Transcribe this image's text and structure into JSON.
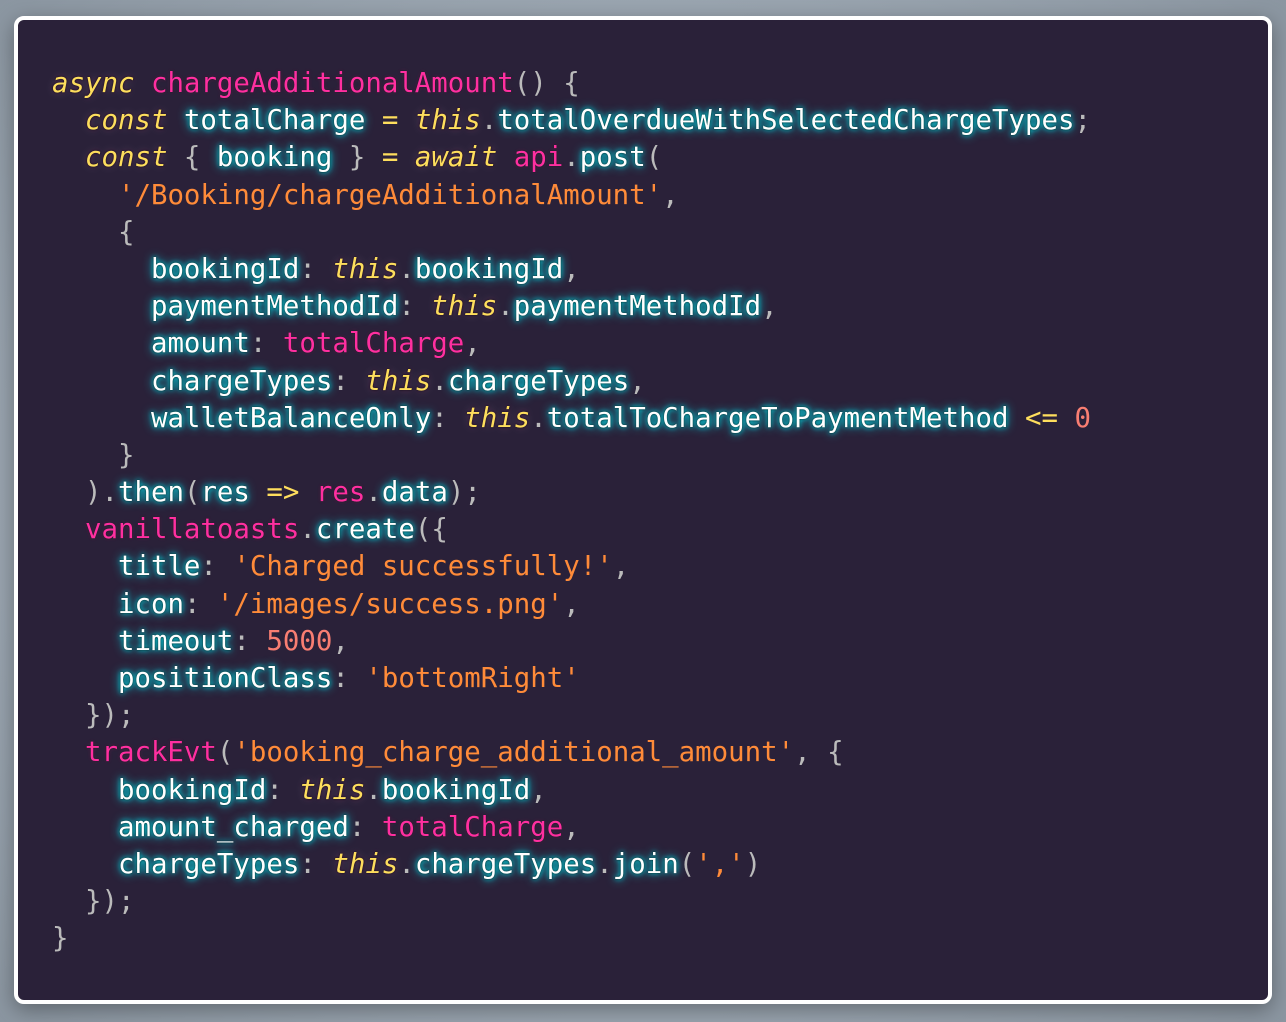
{
  "editor": {
    "language": "javascript",
    "colors": {
      "background": "#2a2139",
      "identifier": "#ffffff",
      "keyword": "#fede5d",
      "function": "#ff2fa0",
      "string": "#ff8b39",
      "number": "#f97e72",
      "punctuation": "#bbbbbb",
      "frame_border": "#ffffff"
    },
    "lines": [
      [
        {
          "k": "kw",
          "v": "async"
        },
        {
          "k": "p",
          "v": " "
        },
        {
          "k": "fn",
          "v": "chargeAdditionalAmount"
        },
        {
          "k": "p",
          "v": "() {"
        }
      ],
      [
        {
          "k": "p",
          "v": "  "
        },
        {
          "k": "kw",
          "v": "const"
        },
        {
          "k": "p",
          "v": " "
        },
        {
          "k": "t",
          "v": "totalCharge"
        },
        {
          "k": "p",
          "v": " "
        },
        {
          "k": "op",
          "v": "="
        },
        {
          "k": "p",
          "v": " "
        },
        {
          "k": "kw",
          "v": "this"
        },
        {
          "k": "p",
          "v": "."
        },
        {
          "k": "t",
          "v": "totalOverdueWithSelectedChargeTypes"
        },
        {
          "k": "p",
          "v": ";"
        }
      ],
      [
        {
          "k": "p",
          "v": "  "
        },
        {
          "k": "kw",
          "v": "const"
        },
        {
          "k": "p",
          "v": " { "
        },
        {
          "k": "t",
          "v": "booking"
        },
        {
          "k": "p",
          "v": " } "
        },
        {
          "k": "op",
          "v": "="
        },
        {
          "k": "p",
          "v": " "
        },
        {
          "k": "kw",
          "v": "await"
        },
        {
          "k": "p",
          "v": " "
        },
        {
          "k": "fn",
          "v": "api"
        },
        {
          "k": "p",
          "v": "."
        },
        {
          "k": "t",
          "v": "post"
        },
        {
          "k": "p",
          "v": "("
        }
      ],
      [
        {
          "k": "p",
          "v": "    "
        },
        {
          "k": "str",
          "v": "'/Booking/chargeAdditionalAmount'"
        },
        {
          "k": "p",
          "v": ","
        }
      ],
      [
        {
          "k": "p",
          "v": "    {"
        }
      ],
      [
        {
          "k": "p",
          "v": "      "
        },
        {
          "k": "t",
          "v": "bookingId"
        },
        {
          "k": "p",
          "v": ": "
        },
        {
          "k": "kw",
          "v": "this"
        },
        {
          "k": "p",
          "v": "."
        },
        {
          "k": "t",
          "v": "bookingId"
        },
        {
          "k": "p",
          "v": ","
        }
      ],
      [
        {
          "k": "p",
          "v": "      "
        },
        {
          "k": "t",
          "v": "paymentMethodId"
        },
        {
          "k": "p",
          "v": ": "
        },
        {
          "k": "kw",
          "v": "this"
        },
        {
          "k": "p",
          "v": "."
        },
        {
          "k": "t",
          "v": "paymentMethodId"
        },
        {
          "k": "p",
          "v": ","
        }
      ],
      [
        {
          "k": "p",
          "v": "      "
        },
        {
          "k": "t",
          "v": "amount"
        },
        {
          "k": "p",
          "v": ": "
        },
        {
          "k": "fn",
          "v": "totalCharge"
        },
        {
          "k": "p",
          "v": ","
        }
      ],
      [
        {
          "k": "p",
          "v": "      "
        },
        {
          "k": "t",
          "v": "chargeTypes"
        },
        {
          "k": "p",
          "v": ": "
        },
        {
          "k": "kw",
          "v": "this"
        },
        {
          "k": "p",
          "v": "."
        },
        {
          "k": "t",
          "v": "chargeTypes"
        },
        {
          "k": "p",
          "v": ","
        }
      ],
      [
        {
          "k": "p",
          "v": "      "
        },
        {
          "k": "t",
          "v": "walletBalanceOnly"
        },
        {
          "k": "p",
          "v": ": "
        },
        {
          "k": "kw",
          "v": "this"
        },
        {
          "k": "p",
          "v": "."
        },
        {
          "k": "t",
          "v": "totalToChargeToPaymentMethod"
        },
        {
          "k": "p",
          "v": " "
        },
        {
          "k": "op",
          "v": "<="
        },
        {
          "k": "p",
          "v": " "
        },
        {
          "k": "num",
          "v": "0"
        }
      ],
      [
        {
          "k": "p",
          "v": "    }"
        }
      ],
      [
        {
          "k": "p",
          "v": "  )."
        },
        {
          "k": "t",
          "v": "then"
        },
        {
          "k": "p",
          "v": "("
        },
        {
          "k": "t",
          "v": "res"
        },
        {
          "k": "p",
          "v": " "
        },
        {
          "k": "op",
          "v": "=>"
        },
        {
          "k": "p",
          "v": " "
        },
        {
          "k": "fn",
          "v": "res"
        },
        {
          "k": "p",
          "v": "."
        },
        {
          "k": "t",
          "v": "data"
        },
        {
          "k": "p",
          "v": ");"
        }
      ],
      [
        {
          "k": "p",
          "v": "  "
        },
        {
          "k": "fn",
          "v": "vanillatoasts"
        },
        {
          "k": "p",
          "v": "."
        },
        {
          "k": "t",
          "v": "create"
        },
        {
          "k": "p",
          "v": "({"
        }
      ],
      [
        {
          "k": "p",
          "v": "    "
        },
        {
          "k": "t",
          "v": "title"
        },
        {
          "k": "p",
          "v": ": "
        },
        {
          "k": "str",
          "v": "'Charged successfully!'"
        },
        {
          "k": "p",
          "v": ","
        }
      ],
      [
        {
          "k": "p",
          "v": "    "
        },
        {
          "k": "t",
          "v": "icon"
        },
        {
          "k": "p",
          "v": ": "
        },
        {
          "k": "str",
          "v": "'/images/success.png'"
        },
        {
          "k": "p",
          "v": ","
        }
      ],
      [
        {
          "k": "p",
          "v": "    "
        },
        {
          "k": "t",
          "v": "timeout"
        },
        {
          "k": "p",
          "v": ": "
        },
        {
          "k": "num",
          "v": "5000"
        },
        {
          "k": "p",
          "v": ","
        }
      ],
      [
        {
          "k": "p",
          "v": "    "
        },
        {
          "k": "t",
          "v": "positionClass"
        },
        {
          "k": "p",
          "v": ": "
        },
        {
          "k": "str",
          "v": "'bottomRight'"
        }
      ],
      [
        {
          "k": "p",
          "v": "  });"
        }
      ],
      [
        {
          "k": "p",
          "v": "  "
        },
        {
          "k": "fn",
          "v": "trackEvt"
        },
        {
          "k": "p",
          "v": "("
        },
        {
          "k": "str",
          "v": "'booking_charge_additional_amount'"
        },
        {
          "k": "p",
          "v": ", {"
        }
      ],
      [
        {
          "k": "p",
          "v": "    "
        },
        {
          "k": "t",
          "v": "bookingId"
        },
        {
          "k": "p",
          "v": ": "
        },
        {
          "k": "kw",
          "v": "this"
        },
        {
          "k": "p",
          "v": "."
        },
        {
          "k": "t",
          "v": "bookingId"
        },
        {
          "k": "p",
          "v": ","
        }
      ],
      [
        {
          "k": "p",
          "v": "    "
        },
        {
          "k": "t",
          "v": "amount_charged"
        },
        {
          "k": "p",
          "v": ": "
        },
        {
          "k": "fn",
          "v": "totalCharge"
        },
        {
          "k": "p",
          "v": ","
        }
      ],
      [
        {
          "k": "p",
          "v": "    "
        },
        {
          "k": "t",
          "v": "chargeTypes"
        },
        {
          "k": "p",
          "v": ": "
        },
        {
          "k": "kw",
          "v": "this"
        },
        {
          "k": "p",
          "v": "."
        },
        {
          "k": "t",
          "v": "chargeTypes"
        },
        {
          "k": "p",
          "v": "."
        },
        {
          "k": "t",
          "v": "join"
        },
        {
          "k": "p",
          "v": "("
        },
        {
          "k": "str",
          "v": "','"
        },
        {
          "k": "p",
          "v": ")"
        }
      ],
      [
        {
          "k": "p",
          "v": "  });"
        }
      ],
      [
        {
          "k": "p",
          "v": "}"
        }
      ]
    ]
  }
}
